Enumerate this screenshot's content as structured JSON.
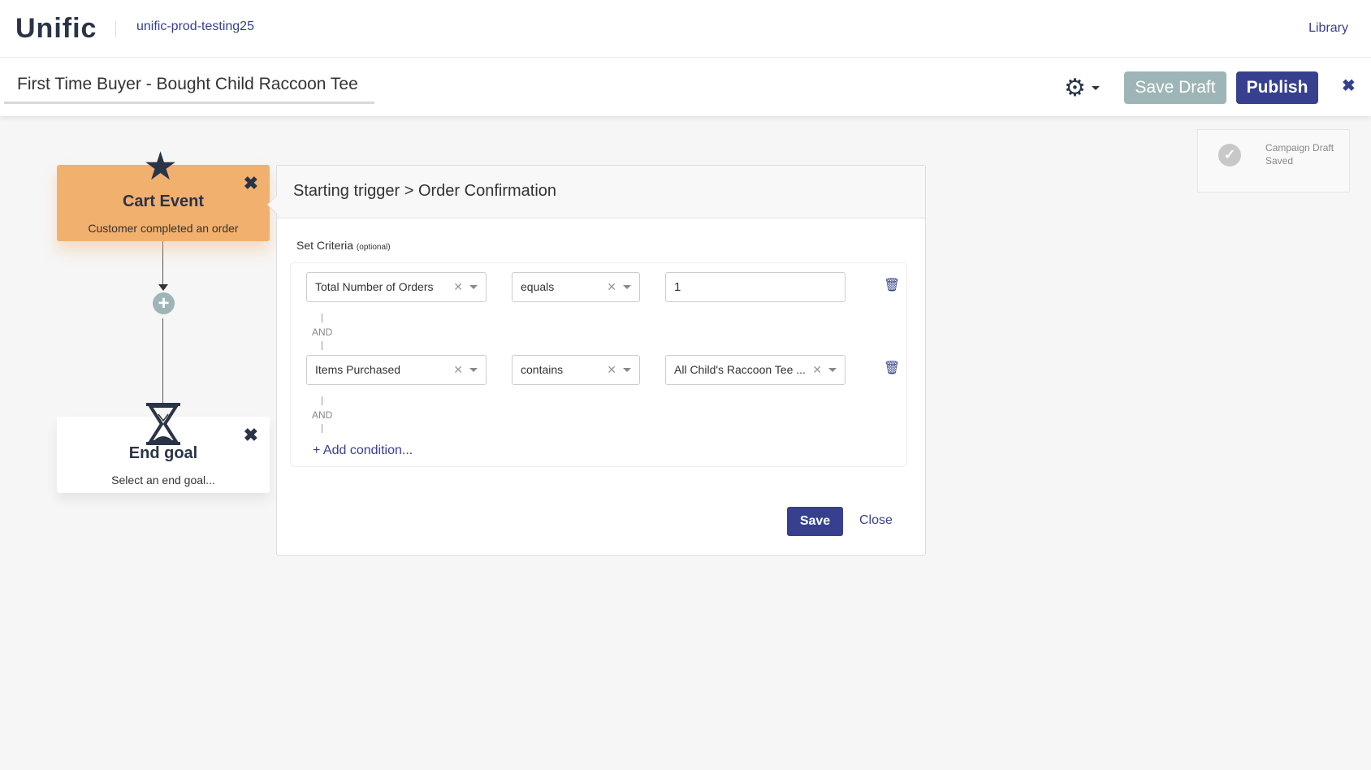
{
  "header": {
    "logo": "Unific",
    "account": "unific-prod-testing25",
    "library_link": "Library"
  },
  "toolbar": {
    "campaign_title": "First Time Buyer - Bought Child Raccoon Tee",
    "gear_icon": "gear-icon",
    "save_draft_label": "Save Draft",
    "publish_label": "Publish",
    "close_icon": "close-icon"
  },
  "toast": {
    "text": "Campaign Draft Saved",
    "icon": "check-circle-icon"
  },
  "workflow": {
    "trigger_card": {
      "title": "Cart Event",
      "subtitle": "Customer completed an order",
      "icon": "star-icon",
      "color": "#f2b06e"
    },
    "add_step_icon": "plus-circle-icon",
    "end_card": {
      "title": "End goal",
      "subtitle": "Select an end goal...",
      "icon": "hourglass-icon"
    }
  },
  "panel": {
    "title": "Starting trigger > Order Confirmation",
    "criteria_label": "Set Criteria",
    "criteria_optional": "(optional)",
    "conditions": [
      {
        "field": "Total Number of Orders",
        "operator": "equals",
        "value": "1"
      },
      {
        "field": "Items Purchased",
        "operator": "contains",
        "value": "All Child's Raccoon Tee ..."
      }
    ],
    "connector": "AND",
    "add_condition": "+ Add condition...",
    "save_label": "Save",
    "close_label": "Close"
  },
  "colors": {
    "primary": "#36408f",
    "save_draft": "#9db5b7",
    "trigger": "#f2b06e"
  }
}
